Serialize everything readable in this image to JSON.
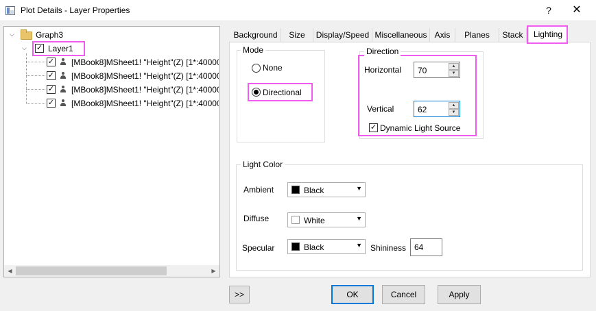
{
  "window": {
    "title": "Plot Details - Layer Properties",
    "help_label": "?",
    "close_label": "✕"
  },
  "tree": {
    "root": "Graph3",
    "layer": "Layer1",
    "plots": [
      "[MBook8]MSheet1! \"Height\"(Z) [1*:40000",
      "[MBook8]MSheet1! \"Height\"(Z) [1*:40000",
      "[MBook8]MSheet1! \"Height\"(Z) [1*:40000",
      "[MBook8]MSheet1! \"Height\"(Z) [1*:40000"
    ]
  },
  "tabs": [
    "Background",
    "Size",
    "Display/Speed",
    "Miscellaneous",
    "Axis",
    "Planes",
    "Stack",
    "Lighting"
  ],
  "active_tab": "Lighting",
  "mode": {
    "label": "Mode",
    "none_label": "None",
    "directional_label": "Directional",
    "selected": "Directional"
  },
  "direction": {
    "label": "Direction",
    "horizontal_label": "Horizontal",
    "horizontal_value": "70",
    "vertical_label": "Vertical",
    "vertical_value": "62",
    "dynamic_label": "Dynamic Light Source",
    "dynamic_checked": true
  },
  "light_color": {
    "label": "Light Color",
    "ambient_label": "Ambient",
    "ambient_value": "Black",
    "ambient_color": "#000000",
    "diffuse_label": "Diffuse",
    "diffuse_value": "White",
    "diffuse_color": "#ffffff",
    "specular_label": "Specular",
    "specular_value": "Black",
    "specular_color": "#000000",
    "shininess_label": "Shininess",
    "shininess_value": "64"
  },
  "buttons": {
    "expand": ">>",
    "ok": "OK",
    "cancel": "Cancel",
    "apply": "Apply"
  },
  "colors": {
    "highlight": "#f05cf0",
    "focus": "#0078d7"
  }
}
